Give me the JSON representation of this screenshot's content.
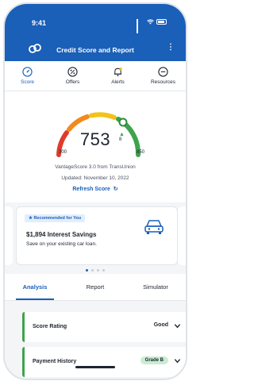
{
  "status_bar": {
    "time": "9:41"
  },
  "header": {
    "title": "Credit Score and Report",
    "more_label": "⋮"
  },
  "top_tabs": [
    {
      "label": "Score",
      "icon": "score-icon",
      "active": true
    },
    {
      "label": "Offers",
      "icon": "percent-icon",
      "active": false
    },
    {
      "label": "Alerts",
      "icon": "bell-icon",
      "active": false
    },
    {
      "label": "Resources",
      "icon": "minus-circle-icon",
      "active": false
    }
  ],
  "score": {
    "value": "753",
    "change": "8",
    "min": "300",
    "max": "850",
    "source": "VantageScore 3.0 from TransUnion",
    "updated": "Updated: November 10, 2022",
    "refresh_label": "Refresh Score"
  },
  "recommendation": {
    "badge": "★ Recommended for You",
    "title": "$1,894 Interest Savings",
    "body": "Save on your existing car loan.",
    "icon": "car-icon"
  },
  "carousel": {
    "page_count": 4,
    "active_index": 0
  },
  "bottom_tabs": [
    {
      "label": "Analysis",
      "active": true
    },
    {
      "label": "Report",
      "active": false
    },
    {
      "label": "Simulator",
      "active": false
    }
  ],
  "analysis_rows": [
    {
      "label": "Score Rating",
      "value": "Good"
    },
    {
      "label": "Payment History",
      "value": "Grade B"
    }
  ],
  "colors": {
    "brand_blue": "#1a5fb8",
    "gauge_red": "#e03b2a",
    "gauge_orange": "#f28a1e",
    "gauge_yellow": "#f2c318",
    "gauge_green": "#3fa34d"
  }
}
